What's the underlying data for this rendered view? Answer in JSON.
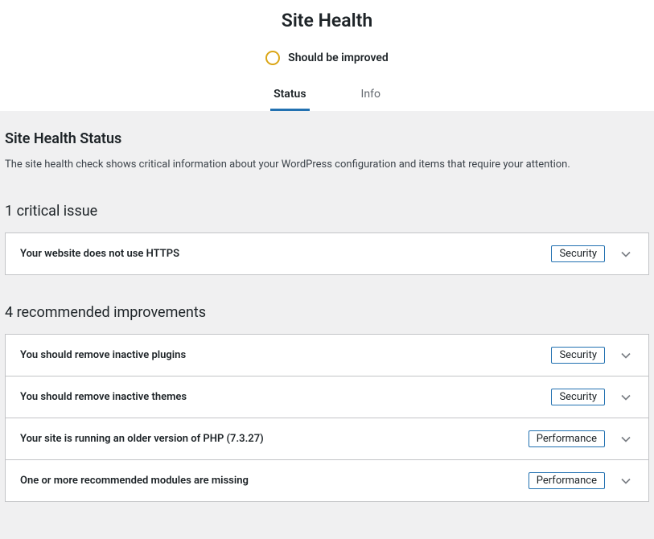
{
  "header": {
    "title": "Site Health",
    "status_text": "Should be improved",
    "tabs": {
      "status": "Status",
      "info": "Info"
    }
  },
  "status_section": {
    "title": "Site Health Status",
    "description": "The site health check shows critical information about your WordPress configuration and items that require your attention."
  },
  "critical": {
    "heading": "1 critical issue",
    "items": [
      {
        "title": "Your website does not use HTTPS",
        "badge": "Security"
      }
    ]
  },
  "recommended": {
    "heading": "4 recommended improvements",
    "items": [
      {
        "title": "You should remove inactive plugins",
        "badge": "Security"
      },
      {
        "title": "You should remove inactive themes",
        "badge": "Security"
      },
      {
        "title": "Your site is running an older version of PHP (7.3.27)",
        "badge": "Performance"
      },
      {
        "title": "One or more recommended modules are missing",
        "badge": "Performance"
      }
    ]
  }
}
